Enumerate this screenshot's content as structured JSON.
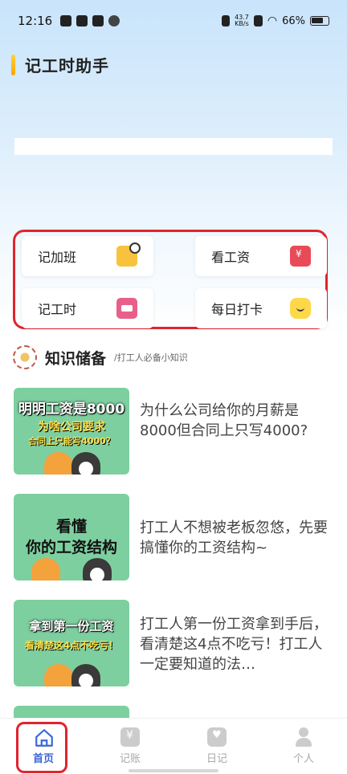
{
  "status_bar": {
    "time": "12:16",
    "net_speed_value": "43.7",
    "net_speed_unit": "KB/s",
    "battery": "66%"
  },
  "app": {
    "title": "记工时助手"
  },
  "quick_actions": [
    {
      "label": "记加班",
      "icon": "overtime-clock-icon"
    },
    {
      "label": "看工资",
      "icon": "salary-wallet-icon"
    },
    {
      "label": "记工时",
      "icon": "hours-card-icon"
    },
    {
      "label": "每日打卡",
      "icon": "daily-checkin-icon"
    }
  ],
  "knowledge": {
    "title": "知识储备",
    "subtitle": "/打工人必备小知识",
    "articles": [
      {
        "thumb_line1": "明明工资是8000",
        "thumb_line2": "为啥公司要求",
        "thumb_line3": "合同上只能写4000？",
        "text": "为什么公司给你的月薪是8000但合同上只写4000?"
      },
      {
        "thumb_line1": "看懂",
        "thumb_line2": "你的工资结构",
        "text": "打工人不想被老板忽悠，先要搞懂你的工资结构~"
      },
      {
        "thumb_line1": "拿到第一份工资",
        "thumb_line2": "看清楚这4点不吃亏！",
        "text": "打工人第一份工资拿到手后，看清楚这4点不吃亏！打工人一定要知道的法…"
      }
    ]
  },
  "bottom_nav": [
    {
      "label": "首页",
      "active": true
    },
    {
      "label": "记账",
      "active": false
    },
    {
      "label": "日记",
      "active": false
    },
    {
      "label": "个人",
      "active": false
    }
  ],
  "colors": {
    "accent_blue": "#3a66d6",
    "highlight_red": "#e0242d",
    "thumb_green": "#7ecfa0"
  }
}
